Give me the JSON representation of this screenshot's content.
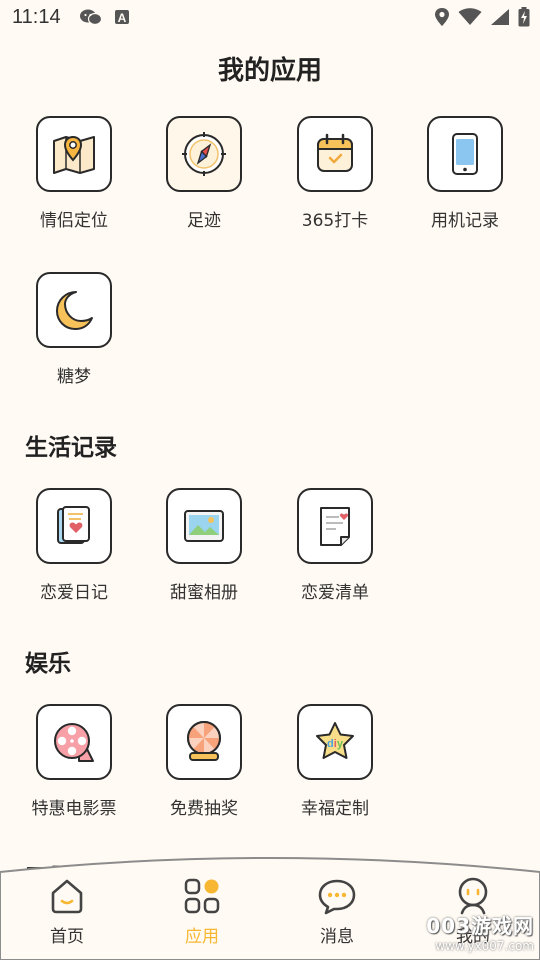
{
  "status_bar": {
    "time": "11:14",
    "left_icons": [
      "wechat-icon",
      "a-notification-icon"
    ],
    "right_icons": [
      "location-icon",
      "wifi-icon",
      "cellular-icon",
      "battery-charging-icon"
    ]
  },
  "page": {
    "title": "我的应用"
  },
  "my_apps": [
    {
      "label": "情侣定位",
      "icon": "map-pin-icon"
    },
    {
      "label": "足迹",
      "icon": "compass-icon"
    },
    {
      "label": "365打卡",
      "icon": "calendar-check-icon"
    },
    {
      "label": "用机记录",
      "icon": "phone-icon"
    },
    {
      "label": "糖梦",
      "icon": "moon-icon"
    }
  ],
  "sections": [
    {
      "title": "生活记录",
      "apps": [
        {
          "label": "恋爱日记",
          "icon": "diary-heart-icon"
        },
        {
          "label": "甜蜜相册",
          "icon": "photo-album-icon"
        },
        {
          "label": "恋爱清单",
          "icon": "checklist-icon"
        }
      ]
    },
    {
      "title": "娱乐",
      "apps": [
        {
          "label": "特惠电影票",
          "icon": "film-reel-icon"
        },
        {
          "label": "免费抽奖",
          "icon": "lottery-ball-icon"
        },
        {
          "label": "幸福定制",
          "icon": "diy-star-icon"
        }
      ]
    }
  ],
  "partial_section_title": "工具",
  "tabbar": {
    "active": "应用",
    "tabs": [
      {
        "label": "首页",
        "icon": "home-icon"
      },
      {
        "label": "应用",
        "icon": "apps-grid-icon"
      },
      {
        "label": "消息",
        "icon": "message-icon"
      },
      {
        "label": "我的",
        "icon": "profile-icon"
      }
    ]
  },
  "watermark": {
    "main": "003游戏网",
    "sub": "www.yx007.com"
  },
  "colors": {
    "background": "#fffaf3",
    "accent": "#f7b733",
    "icon_border": "#2a2a2a"
  }
}
